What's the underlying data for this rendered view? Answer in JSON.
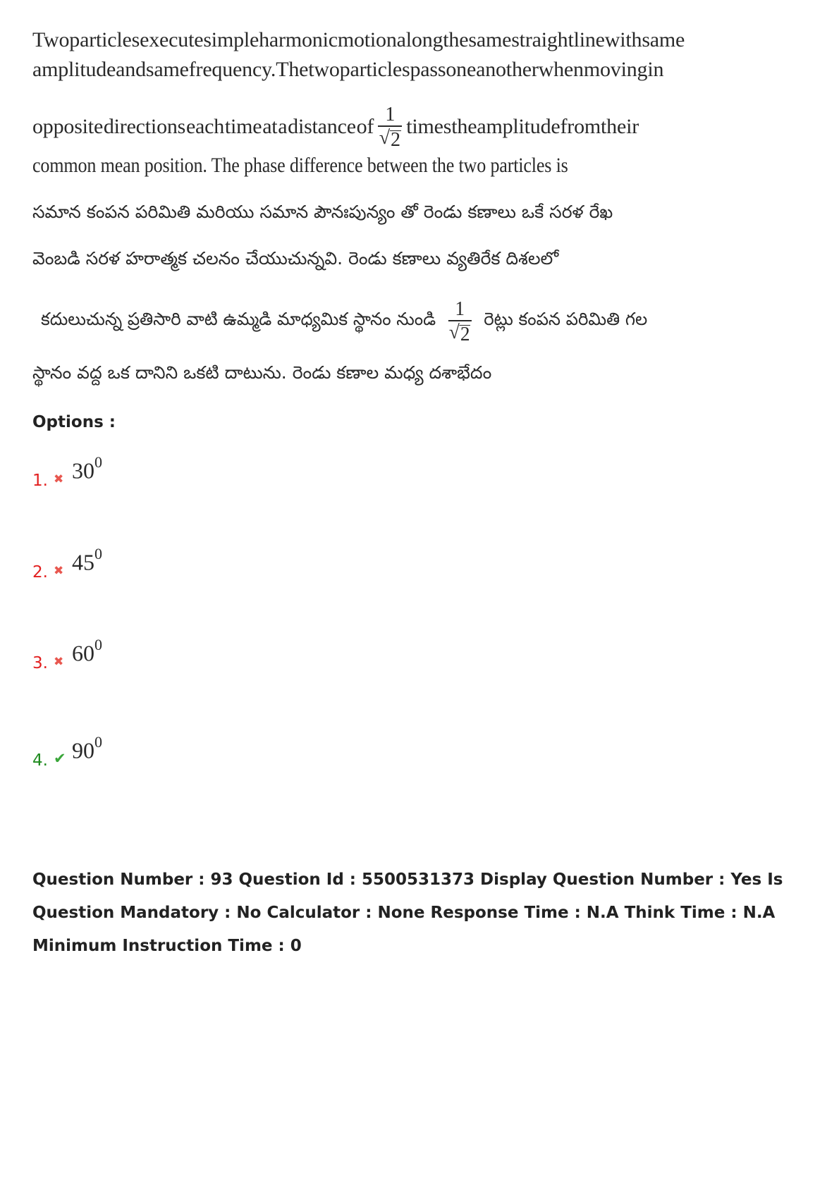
{
  "question": {
    "english": {
      "line1": [
        "Two",
        "particles",
        "execute",
        "simple",
        "harmonic",
        "motion",
        "along",
        "the",
        "same",
        "straight",
        "line",
        "with",
        "same"
      ],
      "line2": [
        "amplitude",
        "and",
        "same",
        "frequency.",
        "The",
        "two",
        "particles",
        "pass",
        "one",
        "another",
        "when",
        "moving",
        "in"
      ],
      "line3_before": [
        "opposite",
        "directions",
        "each",
        "time",
        "at",
        "a",
        "distance",
        "of"
      ],
      "line3_after": [
        "times",
        "the",
        "amplitude",
        "from",
        "their"
      ],
      "line4": "common mean position.  The phase difference between the two particles is"
    },
    "fraction": {
      "numerator": "1",
      "radical": "√",
      "radicand": "2"
    },
    "telugu": {
      "line1": "సమాన కంపన పరిమితి మరియు సమాన పౌనఃపున్యం తో రెండు కణాలు ఒకే సరళ రేఖ",
      "line2": "వెంబడి సరళ హరాత్మక చలనం చేయుచున్నవి. రెండు కణాలు వ్యతిరేక దిశలలో",
      "line3_before": "కదులుచున్న ప్రతిసారి వాటి ఉమ్మడి మాధ్యమిక స్థానం నుండి",
      "line3_after": "రెట్లు కంపన పరిమితి గల",
      "line4": "స్థానం వద్ద ఒక దానిని ఒకటి దాటును. రెండు కణాల మధ్య దశాభేదం"
    }
  },
  "options_label": "Options :",
  "options": [
    {
      "number": "1.",
      "status": "wrong",
      "icon": "cross-icon",
      "value": "30",
      "sup": "0"
    },
    {
      "number": "2.",
      "status": "wrong",
      "icon": "cross-icon",
      "value": "45",
      "sup": "0"
    },
    {
      "number": "3.",
      "status": "wrong",
      "icon": "cross-icon",
      "value": "60",
      "sup": "0"
    },
    {
      "number": "4.",
      "status": "correct",
      "icon": "check-icon",
      "value": "90",
      "sup": "0"
    }
  ],
  "icons": {
    "cross": "✖",
    "check": "✔"
  },
  "colors": {
    "wrong": "#e21f1f",
    "correct": "#1f8b1f"
  },
  "meta": {
    "text": "Question Number : 93 Question Id : 5500531373 Display Question Number : Yes Is Question Mandatory : No Calculator : None Response Time : N.A Think Time : N.A Minimum Instruction Time : 0"
  }
}
